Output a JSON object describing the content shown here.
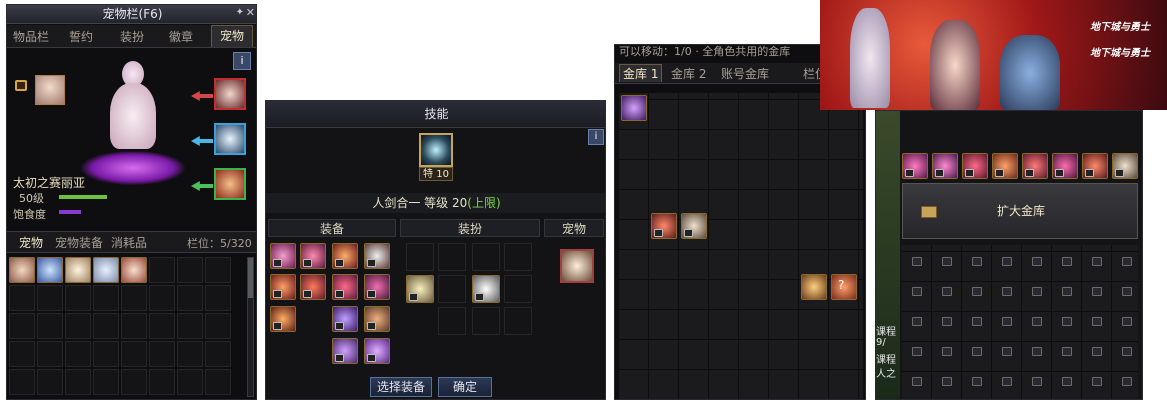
{
  "pet_panel": {
    "title": "宠物栏(F6)",
    "tabs": [
      "物品栏",
      "誓约",
      "装扮",
      "徽章",
      "宠物"
    ],
    "info_icon": "i",
    "pet_name": "太初之赛丽亚",
    "pet_level": "50级",
    "satiety_label": "饱食度",
    "subtabs": [
      "宠物",
      "宠物装备",
      "消耗品"
    ],
    "slot_count": "栏位：5/320"
  },
  "skill_panel": {
    "title": "技能",
    "skill_badge": "特 10",
    "skill_name": "人剑合一 等级 20",
    "skill_limit": "(上限)",
    "section_equip": "装备",
    "section_costume": "装扮",
    "section_pet": "宠物",
    "btn_select": "选择装备",
    "btn_confirm": "确定",
    "info_icon": "i"
  },
  "vault_panel": {
    "title_partial": "可以移动：1/0 · 全角色共用的金库",
    "tabs": [
      "金库 1",
      "金库 2",
      "账号金库",
      "栏位"
    ]
  },
  "expand_panel": {
    "button_label": "扩大金库",
    "side_text": [
      "课程",
      "9/",
      "课程",
      "人之"
    ]
  },
  "banner": {
    "logo_text_1": "地下城与勇士",
    "logo_text_2": "地下城与勇士"
  },
  "colors": {
    "accent_gold": "#c8a45a",
    "skill_green": "#7fd64a",
    "satiety_purple": "#8a3ad0",
    "level_green": "#6cc23c"
  }
}
